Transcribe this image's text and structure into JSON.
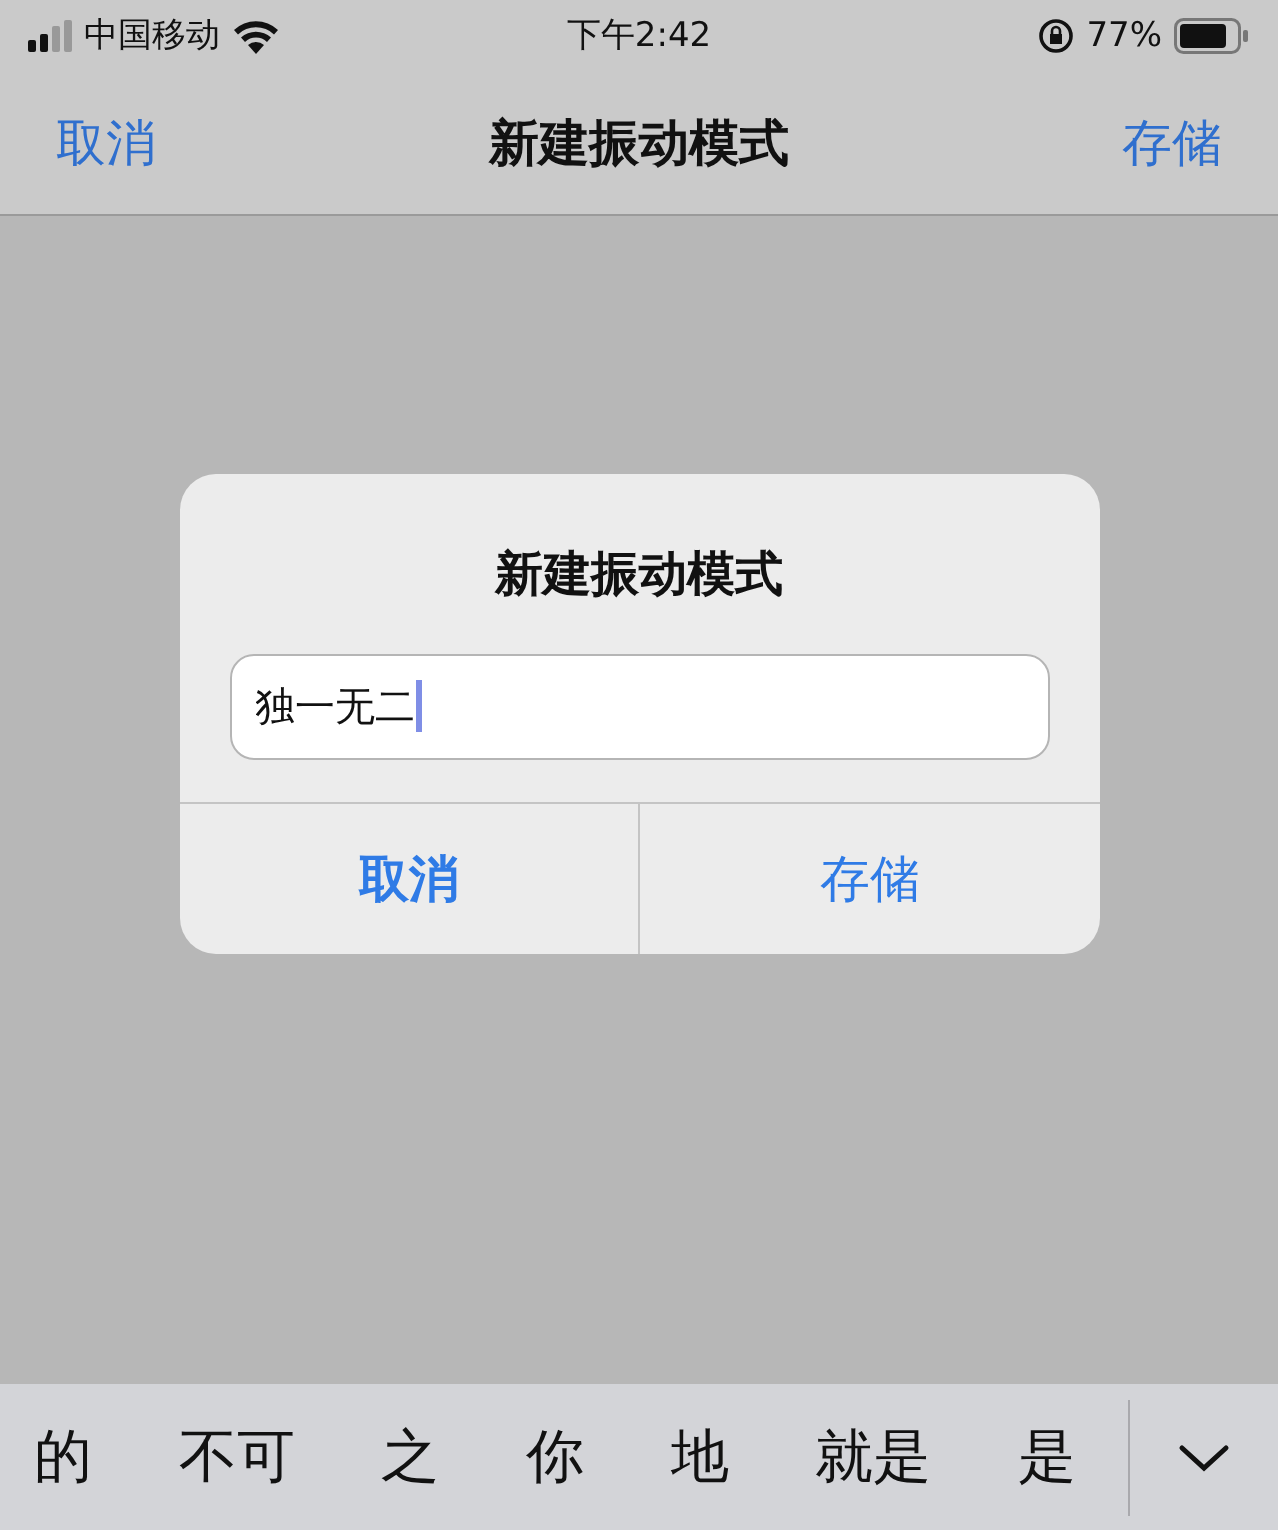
{
  "status_bar": {
    "carrier": "中国移动",
    "time": "下午2:42",
    "battery": "77%"
  },
  "nav_bar": {
    "left": "取消",
    "title": "新建振动模式",
    "right": "存储"
  },
  "dialog": {
    "title": "新建振动模式",
    "field": {
      "value": "独一无二"
    },
    "buttons": [
      {
        "label": "取消",
        "bold": true
      },
      {
        "label": "存储",
        "bold": false
      }
    ]
  },
  "candidates": [
    "的",
    "不可",
    "之",
    "你",
    "地",
    "就是",
    "是"
  ]
}
